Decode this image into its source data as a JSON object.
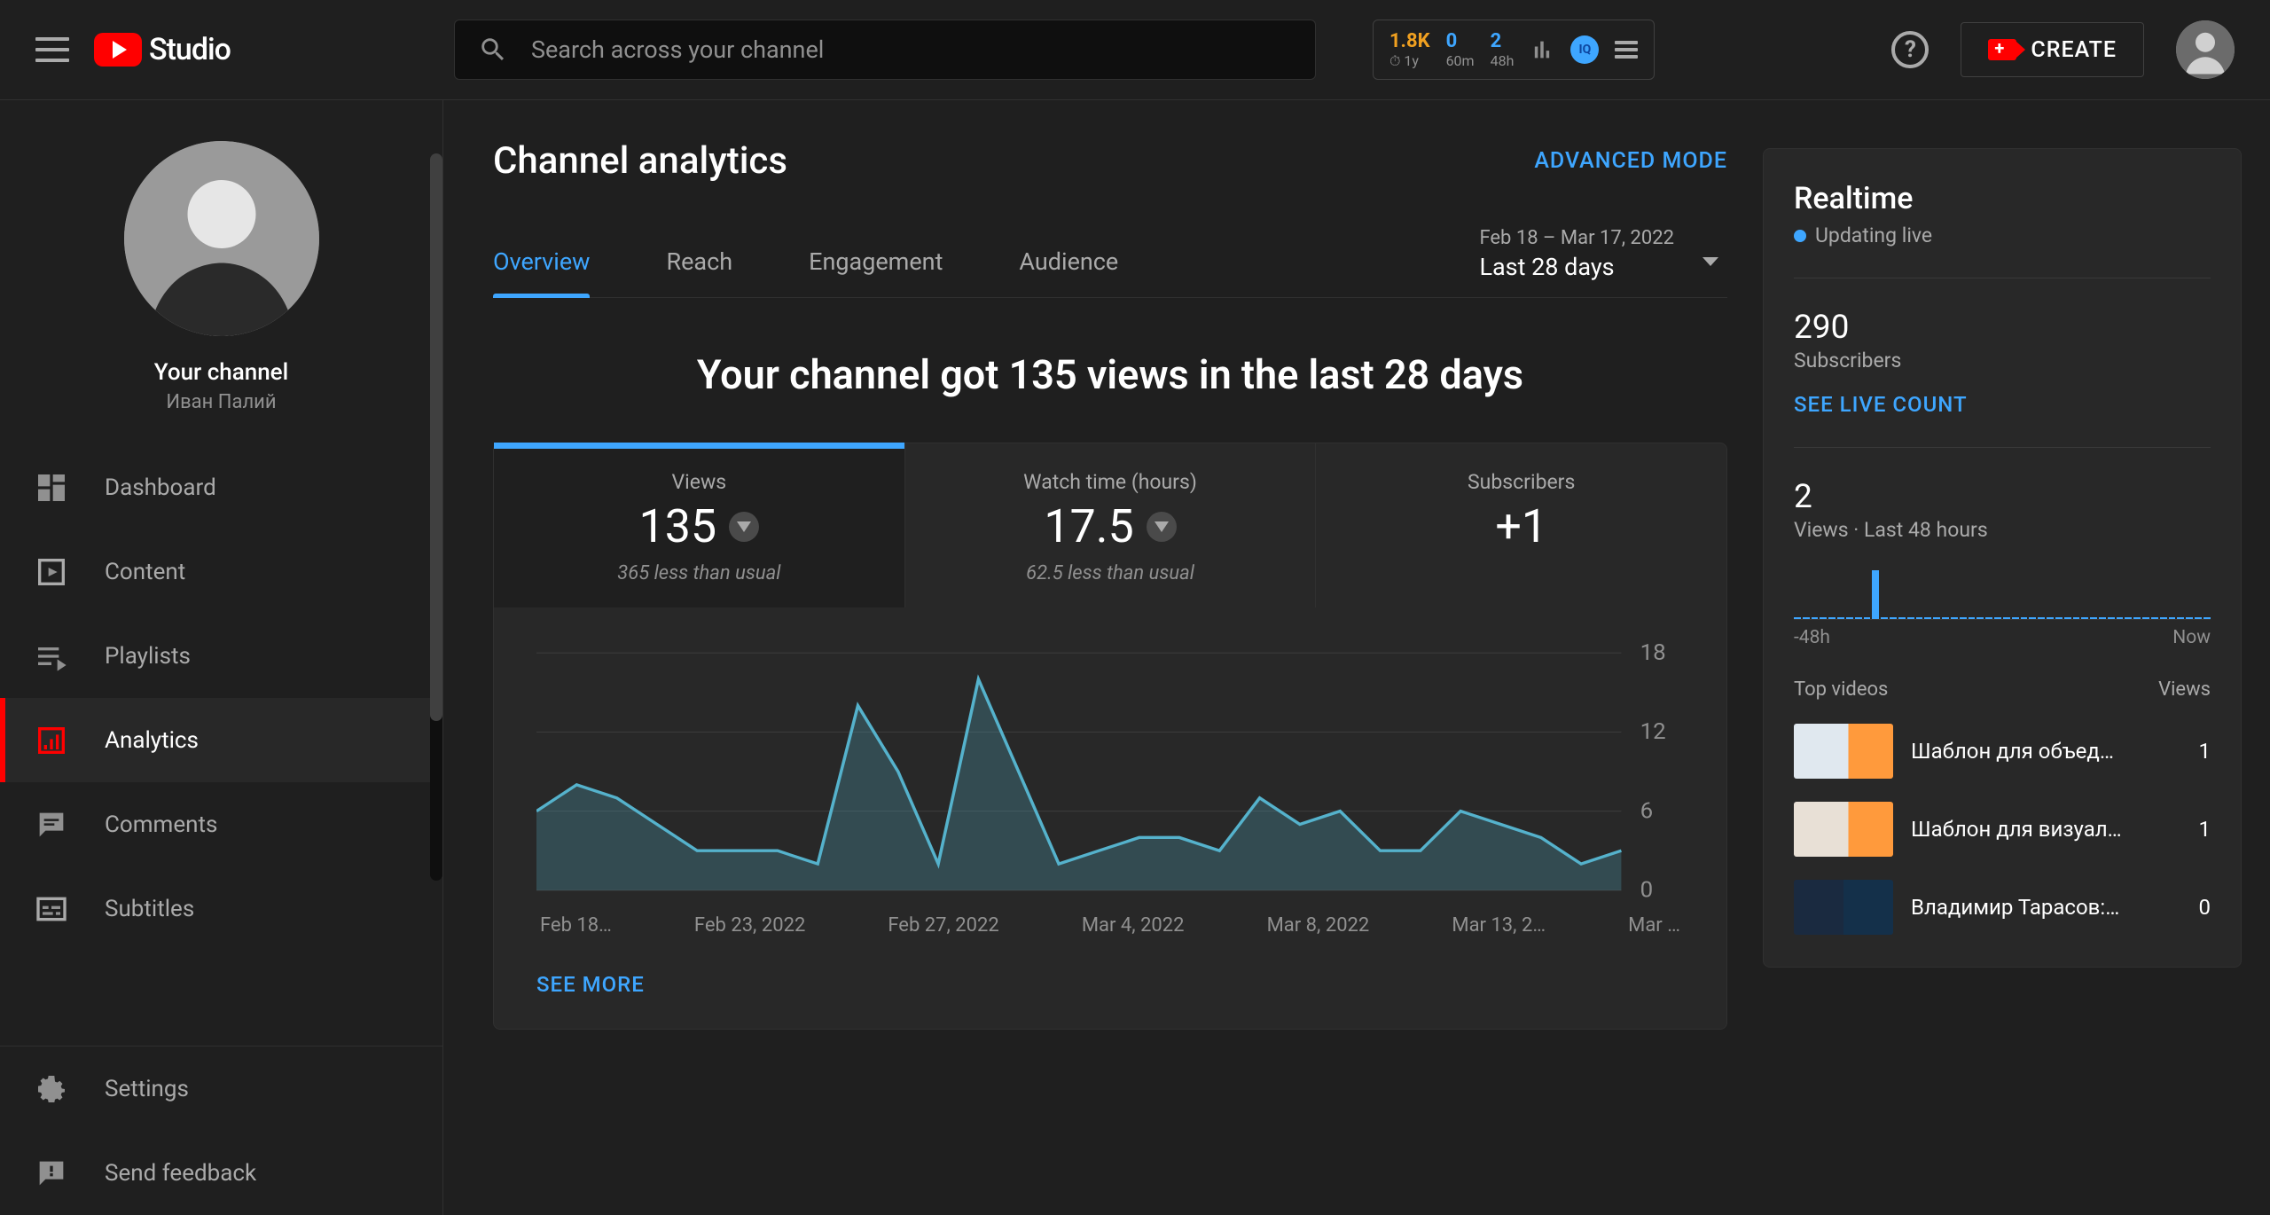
{
  "header": {
    "logo_text": "Studio",
    "search_placeholder": "Search across your channel",
    "stats": [
      {
        "val": "1.8K",
        "sub": "1y"
      },
      {
        "val": "0",
        "sub": "60m"
      },
      {
        "val": "2",
        "sub": "48h"
      }
    ],
    "create_label": "CREATE"
  },
  "sidebar": {
    "profile_title": "Your channel",
    "profile_name": "Иван Палий",
    "items": [
      {
        "icon": "dashboard",
        "label": "Dashboard"
      },
      {
        "icon": "content",
        "label": "Content"
      },
      {
        "icon": "playlists",
        "label": "Playlists"
      },
      {
        "icon": "analytics",
        "label": "Analytics",
        "active": true
      },
      {
        "icon": "comments",
        "label": "Comments"
      },
      {
        "icon": "subtitles",
        "label": "Subtitles"
      }
    ],
    "bottom": [
      {
        "icon": "settings",
        "label": "Settings"
      },
      {
        "icon": "feedback",
        "label": "Send feedback"
      }
    ]
  },
  "page": {
    "title": "Channel analytics",
    "advanced": "ADVANCED MODE",
    "tabs": [
      "Overview",
      "Reach",
      "Engagement",
      "Audience"
    ],
    "active_tab": 0,
    "date_range": "Feb 18 – Mar 17, 2022",
    "date_label": "Last 28 days",
    "headline": "Your channel got 135 views in the last 28 days",
    "metrics": [
      {
        "title": "Views",
        "value": "135",
        "trend": "down",
        "sub": "365 less than usual"
      },
      {
        "title": "Watch time (hours)",
        "value": "17.5",
        "trend": "down",
        "sub": "62.5 less than usual"
      },
      {
        "title": "Subscribers",
        "value": "+1",
        "trend": "",
        "sub": ""
      }
    ],
    "see_more": "SEE MORE"
  },
  "chart_data": {
    "type": "area",
    "title": "Views",
    "xlabel": "",
    "ylabel": "",
    "ylim": [
      0,
      18
    ],
    "y_ticks": [
      0,
      6,
      12,
      18
    ],
    "x_tick_labels": [
      "Feb 18…",
      "Feb 23, 2022",
      "Feb 27, 2022",
      "Mar 4, 2022",
      "Mar 8, 2022",
      "Mar 13, 2…",
      "Mar …"
    ],
    "categories": [
      "Feb 18",
      "Feb 19",
      "Feb 20",
      "Feb 21",
      "Feb 22",
      "Feb 23",
      "Feb 24",
      "Feb 25",
      "Feb 26",
      "Feb 27",
      "Feb 28",
      "Mar 1",
      "Mar 2",
      "Mar 3",
      "Mar 4",
      "Mar 5",
      "Mar 6",
      "Mar 7",
      "Mar 8",
      "Mar 9",
      "Mar 10",
      "Mar 11",
      "Mar 12",
      "Mar 13",
      "Mar 14",
      "Mar 15",
      "Mar 16",
      "Mar 17"
    ],
    "values": [
      6,
      8,
      7,
      5,
      3,
      3,
      3,
      2,
      14,
      9,
      2,
      16,
      9,
      2,
      3,
      4,
      4,
      3,
      7,
      5,
      6,
      3,
      3,
      6,
      5,
      4,
      2,
      3
    ],
    "color": "#55b2cc"
  },
  "realtime": {
    "title": "Realtime",
    "updating": "Updating live",
    "subs_count": "290",
    "subs_label": "Subscribers",
    "live_link": "SEE LIVE COUNT",
    "views48_count": "2",
    "views48_label": "Views · Last 48 hours",
    "mini_axis_left": "-48h",
    "mini_axis_right": "Now",
    "mini_bars_48": [
      0,
      0,
      0,
      0,
      0,
      0,
      0,
      0,
      0,
      1,
      0,
      0,
      0,
      0,
      0,
      0,
      0,
      0,
      0,
      0,
      0,
      0,
      0,
      0,
      0,
      0,
      0,
      0,
      0,
      0,
      0,
      0,
      0,
      0,
      0,
      0,
      0,
      0,
      0,
      0,
      0,
      0,
      0,
      0,
      0,
      0,
      0,
      0
    ],
    "top_videos_head": "Top videos",
    "views_head": "Views",
    "videos": [
      {
        "title": "Шаблон для объед…",
        "count": "1",
        "thumb": "t1"
      },
      {
        "title": "Шаблон для визуал…",
        "count": "1",
        "thumb": "t2"
      },
      {
        "title": "Владимир Тарасов:…",
        "count": "0",
        "thumb": "t3"
      }
    ]
  }
}
